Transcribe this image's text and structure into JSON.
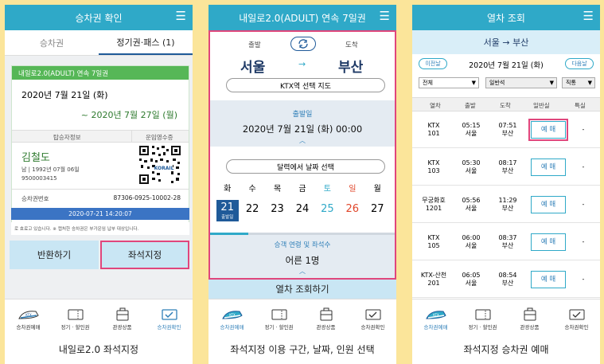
{
  "colors": {
    "header": "#2fa9c8",
    "highlight": "#e0467c",
    "green": "#56b757",
    "navy": "#1f5a99",
    "background": "#fbe59a"
  },
  "bottom_nav": [
    {
      "label": "승차권예매",
      "icon": "ktx-train-icon"
    },
    {
      "label": "정기 · 할인권",
      "icon": "ticket-icon"
    },
    {
      "label": "관광상품",
      "icon": "luggage-icon"
    },
    {
      "label": "승차권확인",
      "icon": "ticket-check-icon"
    }
  ],
  "screen1": {
    "title": "승차권 확인",
    "tabs": [
      "승차권",
      "정기권·패스 (1)"
    ],
    "card_title": "내일로2.0(ADULT) 연속 7일권",
    "start_date": "2020년 7월 21일 (화)",
    "end_date": "~ 2020년 7월 27일 (월)",
    "passenger_label": "탑승자정보",
    "receipt_label": "운임영수증",
    "name": "김철도",
    "info": "남 | 1992년 07월 06일",
    "number": "9500003415",
    "korail": "KORAIL",
    "ticket_no_label": "승차권번호",
    "ticket_no": "87306-0925-10002-28",
    "datetime": "2020-07-21 14:20:07",
    "notice": "로 효료고 있습니다. ※ 캡처한 승차권은 부가운임 납부 대상입니다.",
    "refund_btn": "반환하기",
    "seat_btn": "좌석지정",
    "caption": "내일로2.0 좌석지정"
  },
  "screen2": {
    "title": "내일로2.0(ADULT) 연속 7일권",
    "dep_label": "출발",
    "arr_label": "도착",
    "dep": "서울",
    "arr": "부산",
    "arrow": "→",
    "map_btn": "KTX역 선택 지도",
    "date_label": "출발일",
    "date": "2020년 7월 21일 (화) 00:00",
    "cal_btn": "달력에서 날짜 선택",
    "weekdays": [
      "화",
      "수",
      "목",
      "금",
      "토",
      "일",
      "월"
    ],
    "days": [
      "21",
      "22",
      "23",
      "24",
      "25",
      "26",
      "27"
    ],
    "sel_sub": "출발일",
    "passenger_label": "승객 연령 및 좌석수",
    "passenger": "어른 1명",
    "search_btn": "열차 조회하기",
    "caption": "좌석지정 이용 구간, 날짜, 인원 선택"
  },
  "screen3": {
    "title": "열차 조회",
    "route": "서울 → 부산",
    "prev": "이전날",
    "next": "다음날",
    "date": "2020년 7월 21일 (화)",
    "filters": [
      "전체",
      "일반석",
      "직통"
    ],
    "columns": [
      "열차",
      "출발",
      "도착",
      "일반실",
      "특실"
    ],
    "rows": [
      {
        "train": [
          "KTX",
          "101"
        ],
        "dep": [
          "05:15",
          "서울"
        ],
        "arr": [
          "07:51",
          "부산"
        ],
        "btn": "예 매",
        "special": "-"
      },
      {
        "train": [
          "KTX",
          "103"
        ],
        "dep": [
          "05:30",
          "서울"
        ],
        "arr": [
          "08:17",
          "부산"
        ],
        "btn": "예 매",
        "special": "-"
      },
      {
        "train": [
          "무궁화호",
          "1201"
        ],
        "dep": [
          "05:56",
          "서울"
        ],
        "arr": [
          "11:29",
          "부산"
        ],
        "btn": "예 매",
        "special": "-"
      },
      {
        "train": [
          "KTX",
          "105"
        ],
        "dep": [
          "06:00",
          "서울"
        ],
        "arr": [
          "08:37",
          "부산"
        ],
        "btn": "예 매",
        "special": "-"
      },
      {
        "train": [
          "KTX-산천",
          "201"
        ],
        "dep": [
          "06:05",
          "서울"
        ],
        "arr": [
          "08:54",
          "부산"
        ],
        "btn": "예 매",
        "special": "-"
      }
    ],
    "caption": "좌석지정 승차권 예매"
  }
}
